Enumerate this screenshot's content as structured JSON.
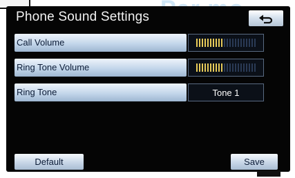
{
  "screen": {
    "title": "Phone Sound Settings"
  },
  "watermark": {
    "text": "Par mo"
  },
  "rows": [
    {
      "label": "Call Volume",
      "level": 0.45
    },
    {
      "label": "Ring Tone Volume",
      "level": 0.45
    },
    {
      "label": "Ring Tone",
      "value": "Tone 1"
    }
  ],
  "buttons": {
    "back_icon": "back-arrow-icon",
    "default_label": "Default",
    "save_label": "Save"
  },
  "colors": {
    "screen_bg": "#050505",
    "button_light": "#c7d6e7",
    "meter_on": "#e8cc5a",
    "meter_off": "#2a3a55"
  }
}
